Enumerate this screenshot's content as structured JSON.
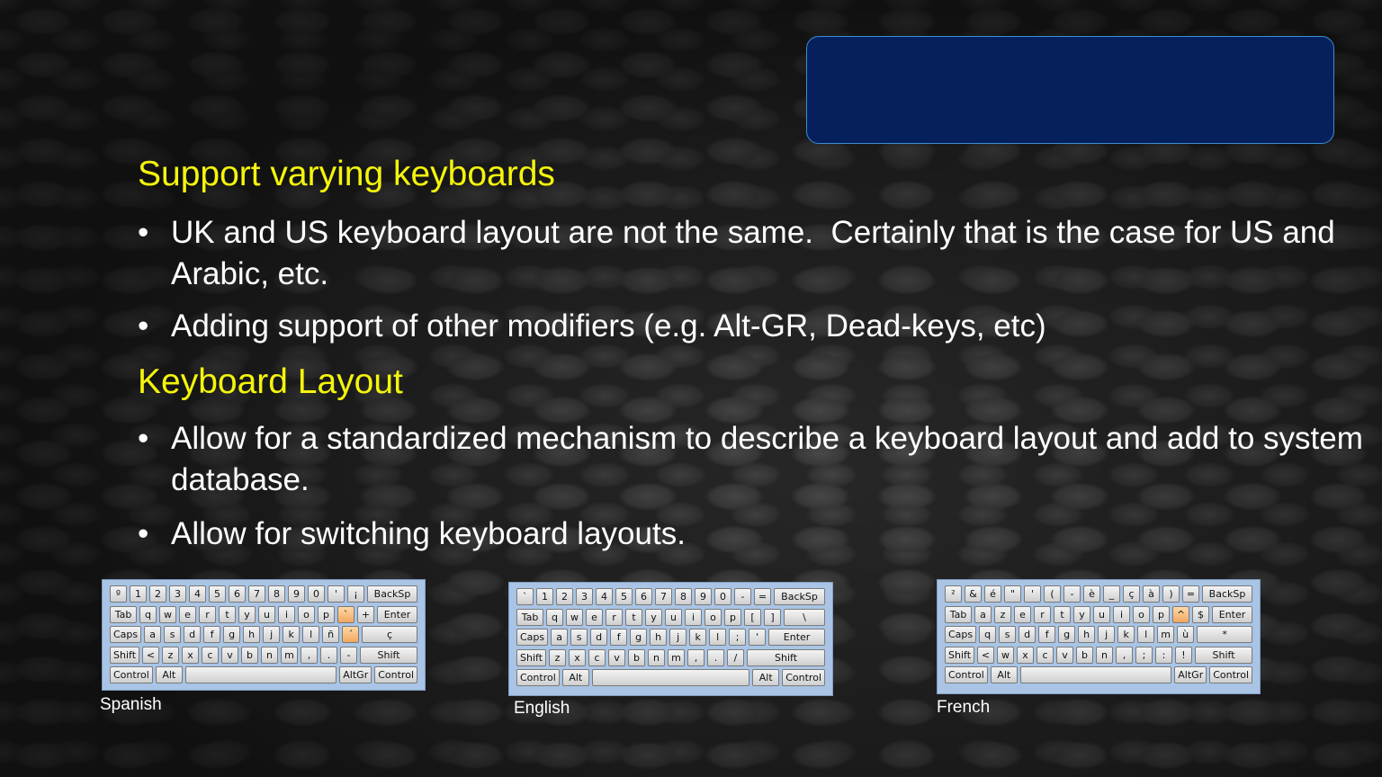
{
  "sections": [
    {
      "heading": "Support varying keyboards",
      "bullets": [
        "UK and US keyboard layout are not the same.  Certainly that is the case for US and Arabic, etc.",
        "Adding support of other modifiers (e.g. Alt-GR, Dead-keys, etc)"
      ]
    },
    {
      "heading": "Keyboard Layout",
      "bullets": [
        "Allow for a standardized mechanism to describe a keyboard layout and add to system database.",
        "Allow for switching keyboard layouts."
      ]
    }
  ],
  "bullet_symbol": "•",
  "keyboards": [
    {
      "caption": "Spanish",
      "rows": [
        [
          "º",
          "1",
          "2",
          "3",
          "4",
          "5",
          "6",
          "7",
          "8",
          "9",
          "0",
          "'",
          "¡",
          "BackSp"
        ],
        [
          "Tab",
          "q",
          "w",
          "e",
          "r",
          "t",
          "y",
          "u",
          "i",
          "o",
          "p",
          "`",
          "+",
          "Enter"
        ],
        [
          "Caps",
          "a",
          "s",
          "d",
          "f",
          "g",
          "h",
          "j",
          "k",
          "l",
          "ñ",
          "´",
          "ç"
        ],
        [
          "Shift",
          "<",
          "z",
          "x",
          "c",
          "v",
          "b",
          "n",
          "m",
          ",",
          ".",
          "-",
          "Shift"
        ],
        [
          "Control",
          "Alt",
          "",
          "AltGr",
          "Control"
        ]
      ],
      "highlight": [
        "`",
        "´"
      ]
    },
    {
      "caption": "English",
      "rows": [
        [
          "`",
          "1",
          "2",
          "3",
          "4",
          "5",
          "6",
          "7",
          "8",
          "9",
          "0",
          "-",
          "=",
          "BackSp"
        ],
        [
          "Tab",
          "q",
          "w",
          "e",
          "r",
          "t",
          "y",
          "u",
          "i",
          "o",
          "p",
          "[",
          "]",
          "\\"
        ],
        [
          "Caps",
          "a",
          "s",
          "d",
          "f",
          "g",
          "h",
          "j",
          "k",
          "l",
          ";",
          "'",
          "Enter"
        ],
        [
          "Shift",
          "z",
          "x",
          "c",
          "v",
          "b",
          "n",
          "m",
          ",",
          ".",
          "/",
          "Shift"
        ],
        [
          "Control",
          "Alt",
          "",
          "Alt",
          "Control"
        ]
      ],
      "highlight": []
    },
    {
      "caption": "French",
      "rows": [
        [
          "²",
          "&",
          "é",
          "\"",
          "'",
          "(",
          "-",
          "è",
          "_",
          "ç",
          "à",
          ")",
          "=",
          "BackSp"
        ],
        [
          "Tab",
          "a",
          "z",
          "e",
          "r",
          "t",
          "y",
          "u",
          "i",
          "o",
          "p",
          "^",
          "$",
          "Enter"
        ],
        [
          "Caps",
          "q",
          "s",
          "d",
          "f",
          "g",
          "h",
          "j",
          "k",
          "l",
          "m",
          "ù",
          "*"
        ],
        [
          "Shift",
          "<",
          "w",
          "x",
          "c",
          "v",
          "b",
          "n",
          ",",
          ";",
          ":",
          "!",
          "Shift"
        ],
        [
          "Control",
          "Alt",
          "",
          "AltGr",
          "Control"
        ]
      ],
      "highlight": [
        "^"
      ]
    }
  ],
  "colors": {
    "heading": "#f4f40c",
    "body_text": "#ffffff",
    "title_box_fill": "#06205e",
    "title_box_border": "#3a8fd0",
    "keyboard_frame": "#a9c4e4",
    "dead_key_highlight": "#f0a860"
  }
}
